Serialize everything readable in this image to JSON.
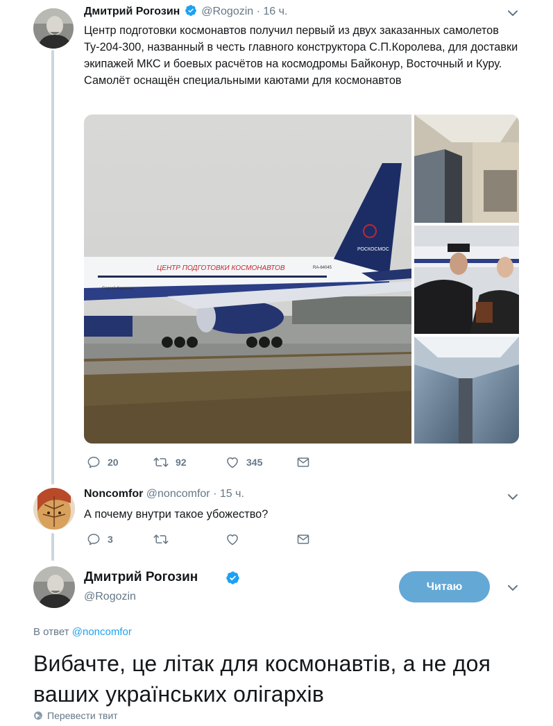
{
  "tweet1": {
    "name": "Дмитрий Рогозин",
    "handle": "@Rogozin",
    "separator": "·",
    "time": "16 ч.",
    "text": "Центр подготовки космонавтов получил первый из двух заказанных самолетов Ту-204-300, названный в честь главного конструктора С.П.Королева, для доставки экипажей МКС и боевых расчётов на космодромы Байконур, Восточный и Куру. Самолёт оснащён специальными каютами для космонавтов",
    "replies": "20",
    "retweets": "92",
    "likes": "345",
    "image_text": {
      "livery": "ЦЕНТР ПОДГОТОВКИ КОСМОНАВТОВ",
      "tail": "РОСКОСМОС",
      "aircraft_name": "Сергей Королев",
      "registration": "RA-64045"
    }
  },
  "tweet2": {
    "name": "Noncomfor",
    "handle": "@noncomfor",
    "separator": "·",
    "time": "15 ч.",
    "text": "А почему внутри такое убожество?",
    "replies": "3"
  },
  "tweet3": {
    "name": "Дмитрий Рогозин",
    "handle": "@Rogozin",
    "follow_label": "Читаю",
    "reply_prefix": "В ответ",
    "reply_handle": "@noncomfor",
    "text": "Вибачте, це літак для космонавтів, а не доя ваших українських олігархів",
    "translate_label": "Перевести твит"
  },
  "colors": {
    "verified": "#1da1f2",
    "link": "#1da1f2",
    "follow_button": "#64a8d6",
    "muted": "#657786",
    "thread_line": "#ccd6dd"
  },
  "icons": [
    "verified-badge-icon",
    "chevron-down-icon",
    "reply-icon",
    "retweet-icon",
    "like-icon",
    "direct-message-icon",
    "globe-icon"
  ]
}
